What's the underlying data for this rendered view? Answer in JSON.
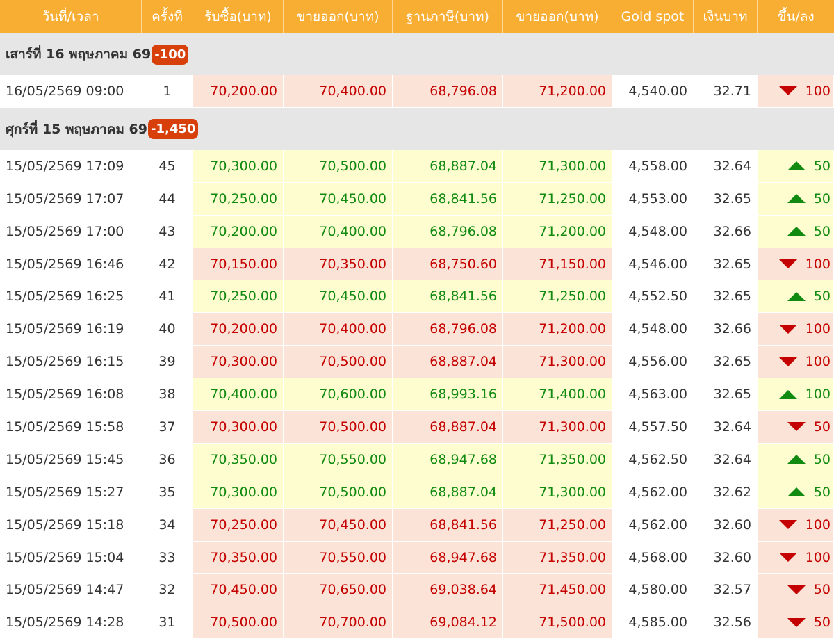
{
  "colors": {
    "header_bg": "#f8ad33",
    "up": "#118a11",
    "down": "#c40000",
    "up_bg": "#fdfdcf",
    "down_bg": "#fbe4d7",
    "badge": "#d8400b"
  },
  "header": [
    "วันที่/เวลา",
    "ครั้งที่",
    "รับซื้อ(บาท)",
    "ขายออก(บาท)",
    "ฐานภาษี(บาท)",
    "ขายออก(บาท)",
    "Gold spot",
    "เงินบาท",
    "ขึ้น/ลง"
  ],
  "groups": [
    {
      "label": "เสาร์ที่ 16 พฤษภาคม 69",
      "change": "-100",
      "rows": [
        {
          "datetime": "16/05/2569 09:00",
          "no": "1",
          "buy": "70,200.00",
          "sell": "70,400.00",
          "tax_base": "68,796.08",
          "sell2": "71,200.00",
          "gold_spot": "4,540.00",
          "thb": "32.71",
          "dir": "down",
          "change": "100"
        }
      ]
    },
    {
      "label": "ศุกร์ที่ 15 พฤษภาคม 69",
      "change": "-1,450",
      "rows": [
        {
          "datetime": "15/05/2569 17:09",
          "no": "45",
          "buy": "70,300.00",
          "sell": "70,500.00",
          "tax_base": "68,887.04",
          "sell2": "71,300.00",
          "gold_spot": "4,558.00",
          "thb": "32.64",
          "dir": "up",
          "change": "50"
        },
        {
          "datetime": "15/05/2569 17:07",
          "no": "44",
          "buy": "70,250.00",
          "sell": "70,450.00",
          "tax_base": "68,841.56",
          "sell2": "71,250.00",
          "gold_spot": "4,553.00",
          "thb": "32.65",
          "dir": "up",
          "change": "50"
        },
        {
          "datetime": "15/05/2569 17:00",
          "no": "43",
          "buy": "70,200.00",
          "sell": "70,400.00",
          "tax_base": "68,796.08",
          "sell2": "71,200.00",
          "gold_spot": "4,548.00",
          "thb": "32.66",
          "dir": "up",
          "change": "50"
        },
        {
          "datetime": "15/05/2569 16:46",
          "no": "42",
          "buy": "70,150.00",
          "sell": "70,350.00",
          "tax_base": "68,750.60",
          "sell2": "71,150.00",
          "gold_spot": "4,546.00",
          "thb": "32.65",
          "dir": "down",
          "change": "100"
        },
        {
          "datetime": "15/05/2569 16:25",
          "no": "41",
          "buy": "70,250.00",
          "sell": "70,450.00",
          "tax_base": "68,841.56",
          "sell2": "71,250.00",
          "gold_spot": "4,552.50",
          "thb": "32.65",
          "dir": "up",
          "change": "50"
        },
        {
          "datetime": "15/05/2569 16:19",
          "no": "40",
          "buy": "70,200.00",
          "sell": "70,400.00",
          "tax_base": "68,796.08",
          "sell2": "71,200.00",
          "gold_spot": "4,548.00",
          "thb": "32.66",
          "dir": "down",
          "change": "100"
        },
        {
          "datetime": "15/05/2569 16:15",
          "no": "39",
          "buy": "70,300.00",
          "sell": "70,500.00",
          "tax_base": "68,887.04",
          "sell2": "71,300.00",
          "gold_spot": "4,556.00",
          "thb": "32.65",
          "dir": "down",
          "change": "100"
        },
        {
          "datetime": "15/05/2569 16:08",
          "no": "38",
          "buy": "70,400.00",
          "sell": "70,600.00",
          "tax_base": "68,993.16",
          "sell2": "71,400.00",
          "gold_spot": "4,563.00",
          "thb": "32.65",
          "dir": "up",
          "change": "100"
        },
        {
          "datetime": "15/05/2569 15:58",
          "no": "37",
          "buy": "70,300.00",
          "sell": "70,500.00",
          "tax_base": "68,887.04",
          "sell2": "71,300.00",
          "gold_spot": "4,557.50",
          "thb": "32.64",
          "dir": "down",
          "change": "50"
        },
        {
          "datetime": "15/05/2569 15:45",
          "no": "36",
          "buy": "70,350.00",
          "sell": "70,550.00",
          "tax_base": "68,947.68",
          "sell2": "71,350.00",
          "gold_spot": "4,562.50",
          "thb": "32.64",
          "dir": "up",
          "change": "50"
        },
        {
          "datetime": "15/05/2569 15:27",
          "no": "35",
          "buy": "70,300.00",
          "sell": "70,500.00",
          "tax_base": "68,887.04",
          "sell2": "71,300.00",
          "gold_spot": "4,562.00",
          "thb": "32.62",
          "dir": "up",
          "change": "50"
        },
        {
          "datetime": "15/05/2569 15:18",
          "no": "34",
          "buy": "70,250.00",
          "sell": "70,450.00",
          "tax_base": "68,841.56",
          "sell2": "71,250.00",
          "gold_spot": "4,562.00",
          "thb": "32.60",
          "dir": "down",
          "change": "100"
        },
        {
          "datetime": "15/05/2569 15:04",
          "no": "33",
          "buy": "70,350.00",
          "sell": "70,550.00",
          "tax_base": "68,947.68",
          "sell2": "71,350.00",
          "gold_spot": "4,568.00",
          "thb": "32.60",
          "dir": "down",
          "change": "100"
        },
        {
          "datetime": "15/05/2569 14:47",
          "no": "32",
          "buy": "70,450.00",
          "sell": "70,650.00",
          "tax_base": "69,038.64",
          "sell2": "71,450.00",
          "gold_spot": "4,580.00",
          "thb": "32.57",
          "dir": "down",
          "change": "50"
        },
        {
          "datetime": "15/05/2569 14:28",
          "no": "31",
          "buy": "70,500.00",
          "sell": "70,700.00",
          "tax_base": "69,084.12",
          "sell2": "71,500.00",
          "gold_spot": "4,585.00",
          "thb": "32.56",
          "dir": "down",
          "change": "50"
        }
      ]
    }
  ]
}
